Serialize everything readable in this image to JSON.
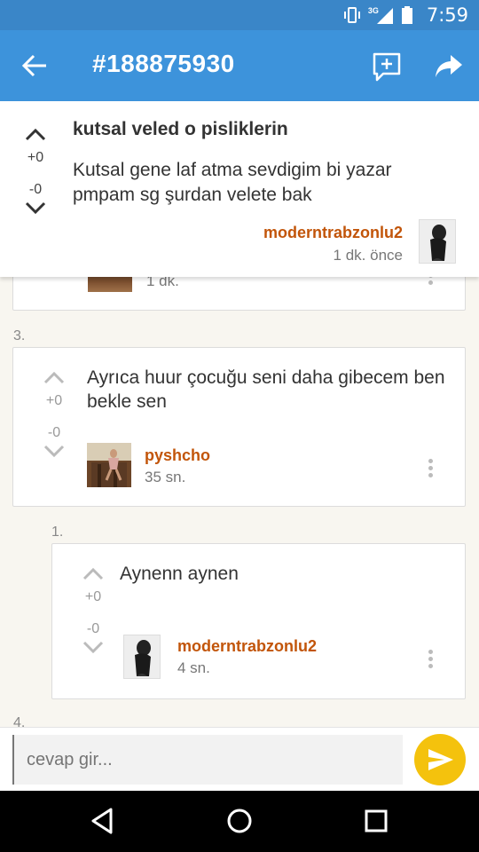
{
  "status_bar": {
    "time": "7:59",
    "network": "3G",
    "icons": [
      "vibrate-icon",
      "signal-icon",
      "battery-icon"
    ]
  },
  "app_bar": {
    "title": "#188875930",
    "icons": [
      "back-arrow-icon",
      "add-comment-icon",
      "share-icon"
    ],
    "color": "#3d93db"
  },
  "thread": {
    "topic": "kutsal veled o pisliklerin",
    "body": "Kutsal gene laf atma sevdigim bi yazar pmpam sg şurdan velete bak",
    "author": "moderntrabzonlu2",
    "time": "1 dk. önce",
    "score_up": "+0",
    "score_down": "-0"
  },
  "previous_comment": {
    "time": "1 dk."
  },
  "comments": [
    {
      "index": "3.",
      "text": "Ayrıca huur çocuğu seni daha gibecem ben bekle sen",
      "author": "pyshcho",
      "time": "35 sn.",
      "score_up": "+0",
      "score_down": "-0"
    },
    {
      "index": "1.",
      "text": "Aynenn aynen",
      "author": "moderntrabzonlu2",
      "time": "4 sn.",
      "score_up": "+0",
      "score_down": "-0"
    }
  ],
  "next_index": "4.",
  "reply": {
    "placeholder": "cevap gir...",
    "send_icon": "send-icon",
    "accent": "#f4c20d"
  },
  "colors": {
    "author": "#c2550a",
    "background": "#f8f6f0"
  }
}
